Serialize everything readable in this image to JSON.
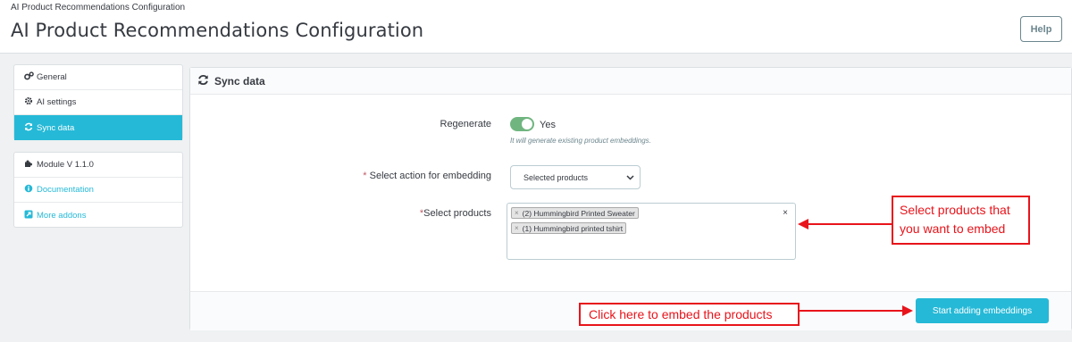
{
  "header": {
    "breadcrumb": "AI Product Recommendations Configuration",
    "title": "AI Product Recommendations Configuration",
    "help_label": "Help"
  },
  "sidebar": {
    "menu": [
      {
        "label": "General",
        "icon": "gears-icon"
      },
      {
        "label": "AI settings",
        "icon": "gear-icon"
      },
      {
        "label": "Sync data",
        "icon": "refresh-icon",
        "active": true
      }
    ],
    "info": [
      {
        "label": "Module V 1.1.0",
        "icon": "puzzle-icon"
      },
      {
        "label": "Documentation",
        "icon": "info-circle-icon"
      },
      {
        "label": "More addons",
        "icon": "external-link-icon"
      }
    ]
  },
  "panel": {
    "title": "Sync data",
    "regenerate": {
      "label": "Regenerate",
      "value_text": "Yes",
      "on": true,
      "help": "It will generate existing product embeddings."
    },
    "action": {
      "required_mark": "*",
      "label": " Select action for embedding",
      "selected": "Selected products"
    },
    "products": {
      "required_mark": "*",
      "label": "Select products",
      "tags": [
        "(2) Hummingbird Printed Sweater",
        "(1) Hummingbird printed tshirt"
      ],
      "tag_remove": "×",
      "clear_all": "×"
    },
    "submit_label": "Start adding embeddings"
  },
  "annotations": {
    "select_products_note": "Select products that you want to embed",
    "embed_note": "Click here to embed the products"
  },
  "colors": {
    "accent": "#25b9d7",
    "toggle_on": "#70b580",
    "callout_red": "#e8141b",
    "required": "#c05c67"
  }
}
